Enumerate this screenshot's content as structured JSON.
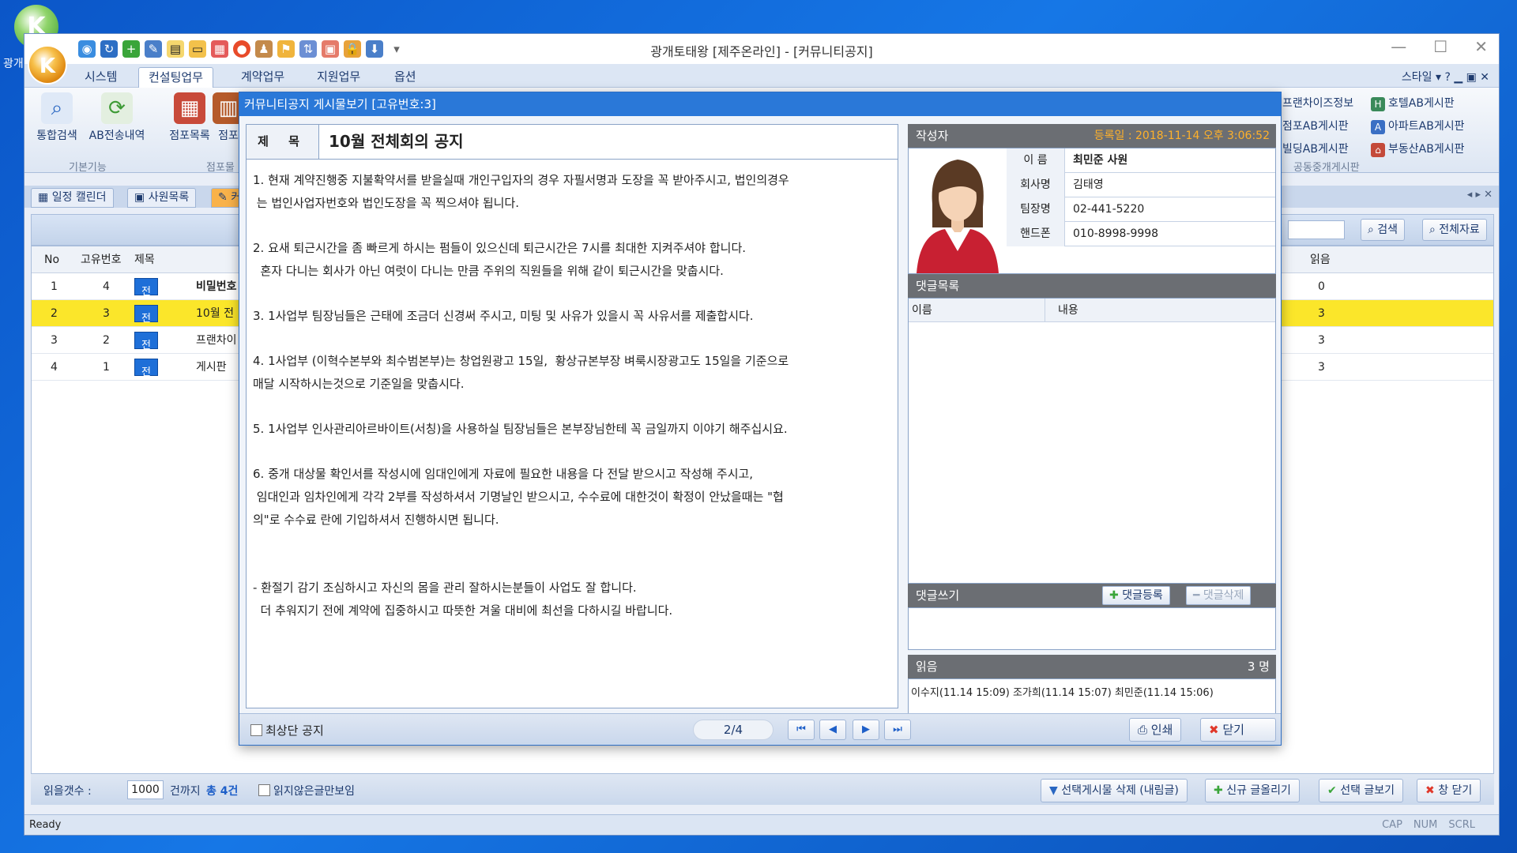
{
  "desktop": {
    "icon_letter": "K",
    "icon_label": "광개"
  },
  "window": {
    "title": "광개토태왕 [제주온라인] - [커뮤니티공지]",
    "app_logo": "K"
  },
  "menu": {
    "tabs": [
      "시스템",
      "컨설팅업무",
      "계약업무",
      "지원업무",
      "옵션"
    ],
    "active": "컨설팅업무",
    "style_label": "스타일"
  },
  "ribbon": {
    "buttons": [
      {
        "label": "통합검색",
        "icon": "search-icon"
      },
      {
        "label": "AB전송내역",
        "icon": "sync-icon"
      },
      {
        "label": "점포목록",
        "icon": "store-icon"
      },
      {
        "label": "점포",
        "icon": "store2-icon"
      }
    ],
    "groups": [
      "기본기능",
      "점포물"
    ],
    "right_col1": [
      "프랜차이즈정보",
      "점포AB게시판",
      "빌딩AB게시판"
    ],
    "right_col2": [
      "호텔AB게시판",
      "아파트AB게시판",
      "부동산AB게시판"
    ],
    "right_group": "공동중개게시판"
  },
  "doctabs": [
    "일정 캘린더",
    "사원목록",
    "커"
  ],
  "toolbar": {
    "search_label": "검색",
    "all_label": "전체자료"
  },
  "grid": {
    "headers": {
      "no": "No",
      "id": "고유번호",
      "title": "제목",
      "read": "읽음"
    },
    "rows": [
      {
        "no": "1",
        "id": "4",
        "badge": "전체공지",
        "title": "비밀번호",
        "read": "0"
      },
      {
        "no": "2",
        "id": "3",
        "badge": "전체공지",
        "title": "10월 전",
        "read": "3"
      },
      {
        "no": "3",
        "id": "2",
        "badge": "전체공지",
        "title": "프랜차이",
        "read": "3"
      },
      {
        "no": "4",
        "id": "1",
        "badge": "전체공지",
        "title": "게시판 ",
        "read": "3"
      }
    ]
  },
  "bottom": {
    "read_count_label": "읽을갯수 :",
    "read_count_value": "1000",
    "until_label": "건까지",
    "total_label": "총 4건",
    "unread_only_label": "읽지않은글만보임",
    "delete_label": "선택게시물 삭제 (내림글)",
    "new_post_label": "신규 글올리기",
    "view_label": "선택 글보기",
    "close_label": "창 닫기"
  },
  "status": {
    "ready": "Ready",
    "keys": [
      "CAP",
      "NUM",
      "SCRL"
    ]
  },
  "dialog": {
    "title": "커뮤니티공지 게시물보기 [고유번호:3]",
    "subject_label": "제 목",
    "subject": "10월 전체회의 공지",
    "paragraphs": [
      "1. 현재 계약진행중 지불확약서를 받을실때 개인구입자의 경우 자필서명과 도장을 꼭 받아주시고, 법인의경우\n 는 법인사업자번호와 법인도장을 꼭 찍으셔야 됩니다.",
      "2. 요새 퇴근시간을 좀 빠르게 하시는 펌들이 있으신데 퇴근시간은 7시를 최대한 지켜주셔야 합니다.\n  혼자 다니는 회사가 아닌 여럿이 다니는 만큼 주위의 직원들을 위해 같이 퇴근시간을 맞춥시다.",
      "3. 1사업부 팀장님들은 근태에 조금더 신경써 주시고, 미팅 및 사유가 있을시 꼭 사유서를 제출합시다.",
      "4. 1사업부 (이혁수본부와 최수범본부)는 창업원광고 15일,  황상규본부장 벼룩시장광고도 15일을 기준으로\n매달 시작하시는것으로 기준일을 맞춥시다.",
      "5. 1사업부 인사관리아르바이트(서칭)을 사용하실 팀장님들은 본부장님한테 꼭 금일까지 이야기 해주십시요.",
      "6. 중개 대상물 확인서를 작성시에 임대인에게 자료에 필요한 내용을 다 전달 받으시고 작성해 주시고,\n 임대인과 임차인에게 각각 2부를 작성하셔서 기명날인 받으시고, 수수료에 대한것이 확정이 안났을때는 \"협\n의\"로 수수료 란에 기입하셔서 진행하시면 됩니다.",
      "\n- 환절기 감기 조심하시고 자신의 몸을 관리 잘하시는분들이 사업도 잘 합니다.\n  더 추워지기 전에 계약에 집중하시고 따뜻한 겨울 대비에 최선을 다하시길 바랍니다."
    ],
    "author": {
      "header": "작성자",
      "reg_date": "등록일 : 2018-11-14 오후 3:06:52",
      "rows": [
        {
          "k": "이 름",
          "v": "최민준 사원"
        },
        {
          "k": "회사명",
          "v": "김태영"
        },
        {
          "k": "팀장명",
          "v": "02-441-5220"
        },
        {
          "k": "핸드폰",
          "v": "010-8998-9998"
        }
      ]
    },
    "comments": {
      "header": "댓글목록",
      "col_name": "이름",
      "col_content": "내용",
      "write_header": "댓글쓰기",
      "add_label": "댓글등록",
      "delete_label": "댓글삭제"
    },
    "readers": {
      "header": "읽음",
      "count": "3 명",
      "list": "이수지(11.14 15:09) 조가희(11.14 15:07) 최민준(11.14 15:06)"
    },
    "footer": {
      "top_notice_label": "최상단 공지",
      "pager": "2/4",
      "print_label": "인쇄",
      "close_label": "닫기"
    }
  }
}
